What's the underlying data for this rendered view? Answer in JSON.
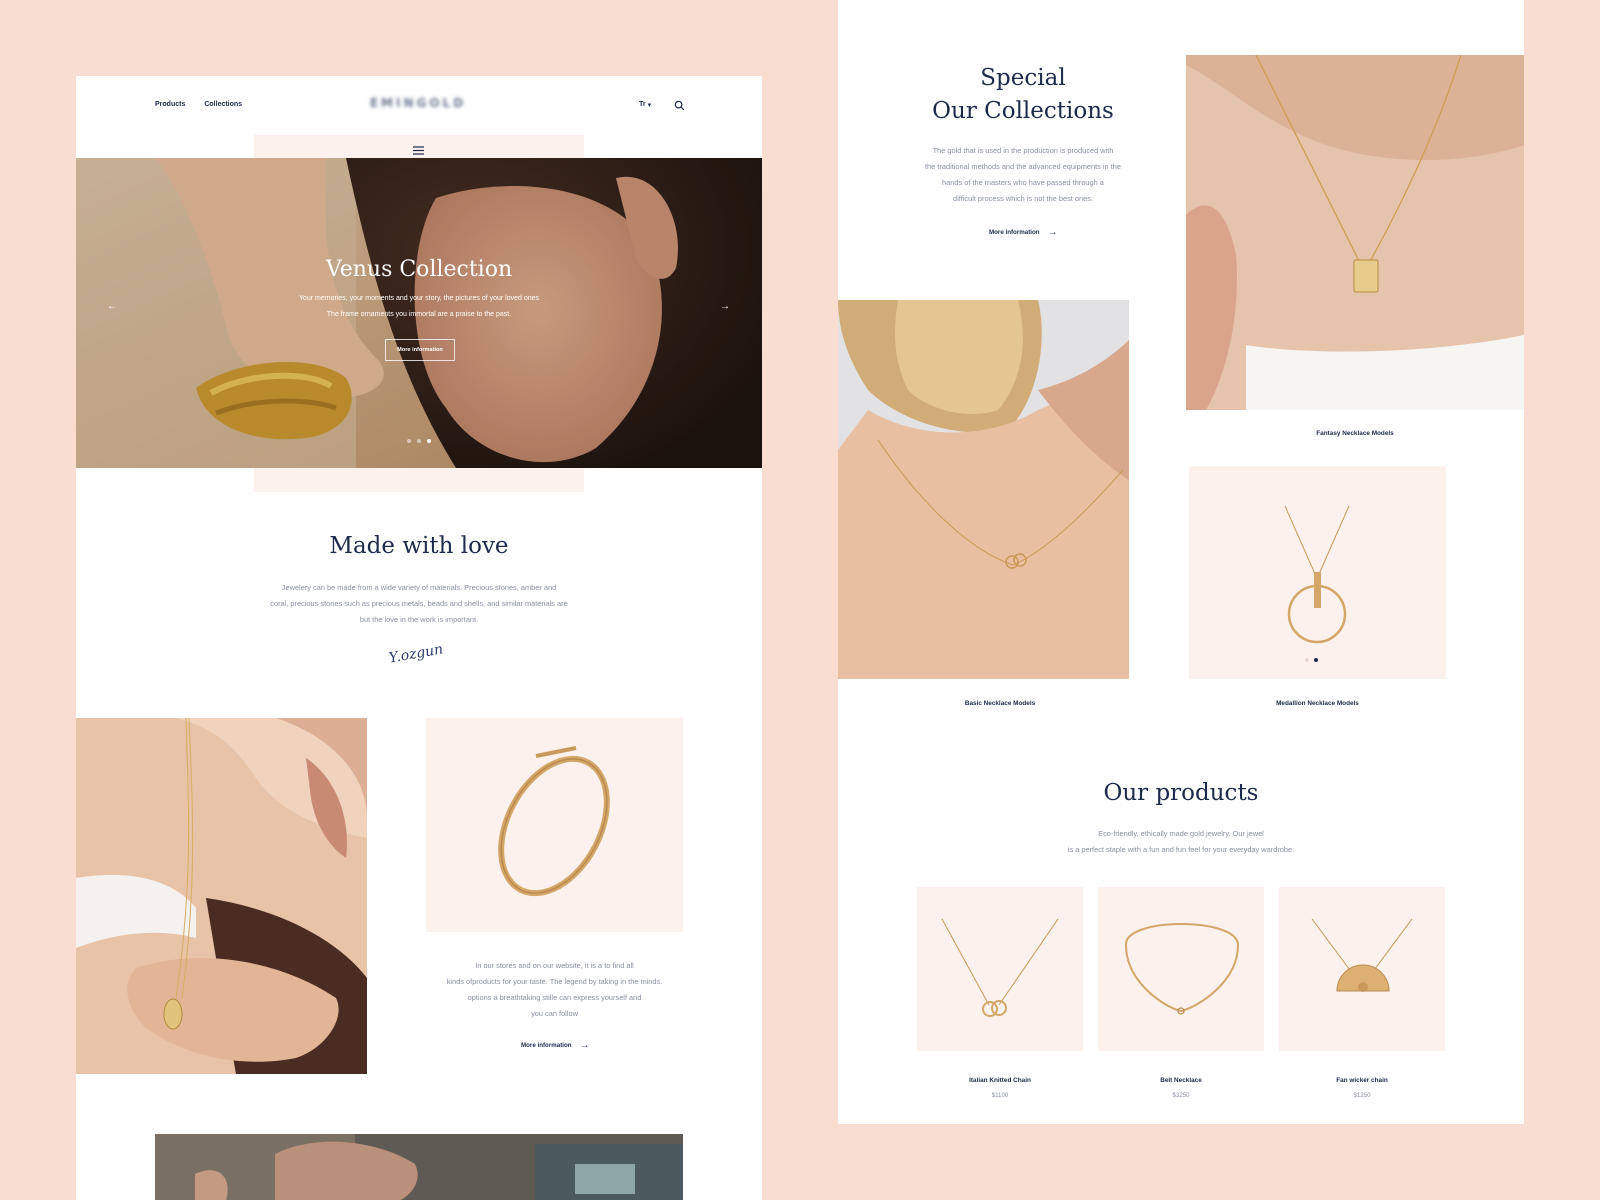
{
  "header": {
    "nav": [
      "Products",
      "Collections"
    ],
    "logo": "EMINGOLD",
    "lang": "Tr",
    "lang_caret": "▾",
    "menu_icon": "hamburger-icon",
    "search_icon": "search-icon"
  },
  "hero": {
    "title": "Venus Collection",
    "line1": "Your memories, your moments and your story, the pictures of your loved ones",
    "line2": "The frame ornaments you immortal are a praise to the past.",
    "button": "More information",
    "prev": "←",
    "next": "→",
    "slide_count": 3,
    "active_slide": 3
  },
  "love": {
    "title": "Made with love",
    "line1": "Jewelery can be made from a wide variety of materials. Precious stones, amber and",
    "line2": "coral, precious stones such as precious metals, beads and shells, and similar materials are",
    "line3": "but the love in the work is important.",
    "signature": "Y.ozgun"
  },
  "stores": {
    "line1": "In our stores and on our website, it is a to find all",
    "line2": "kinds ofproducts for your taste. The legend by taking in the minds.",
    "line3": "options a breathtaking stille can express yourself and",
    "line4": "you can follow",
    "link": "More information",
    "arrow": "→"
  },
  "collections": {
    "title1": "Special",
    "title2": "Our Collections",
    "line1": "The gold that is used in the production is produced with",
    "line2": "the traditional methods and the advanced equipments in the",
    "line3": "hands of the masters who have passed through a",
    "line4": "difficult process which is not the best ones.",
    "link": "More information",
    "arrow": "→",
    "items": [
      "Fantasy Necklace Models",
      "Basic Necklace Models",
      "Medallion Necklace Models"
    ]
  },
  "products": {
    "title": "Our products",
    "line1": "Eco-friendly, ethically made gold jewelry. Our jewel",
    "line2": "is a perfect staple with a fun and fun feel for your everyday wardrobe.",
    "items": [
      {
        "name": "Italian Knitted Chain",
        "price": "$1100"
      },
      {
        "name": "Belt Necklace",
        "price": "$3250"
      },
      {
        "name": "Fan wicker chain",
        "price": "$1250"
      }
    ]
  },
  "colors": {
    "background": "#f9ddd1",
    "navy": "#1d2a4b",
    "pink_box": "#fcf1ec",
    "gold": "#d4a668"
  }
}
